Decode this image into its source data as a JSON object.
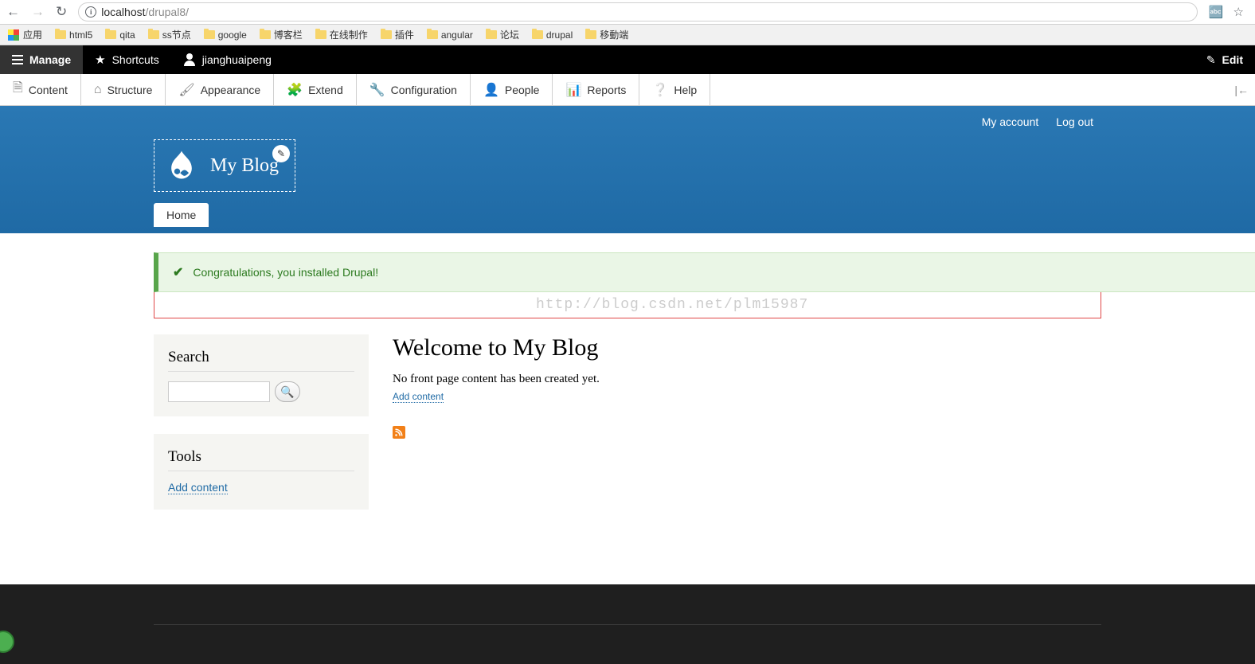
{
  "browser": {
    "url_host": "localhost",
    "url_rest": "/drupal8/",
    "apps_label": "应用",
    "bookmarks": [
      "html5",
      "qita",
      "ss节点",
      "google",
      "博客栏",
      "在线制作",
      "插件",
      "angular",
      "论坛",
      "drupal",
      "移動端"
    ]
  },
  "adminbar": {
    "manage": "Manage",
    "shortcuts": "Shortcuts",
    "user": "jianghuaipeng",
    "edit": "Edit"
  },
  "admintabs": [
    "Content",
    "Structure",
    "Appearance",
    "Extend",
    "Configuration",
    "People",
    "Reports",
    "Help"
  ],
  "userlinks": {
    "myaccount": "My account",
    "logout": "Log out"
  },
  "branding": {
    "site_name": "My Blog"
  },
  "nav": {
    "home": "Home"
  },
  "message": {
    "text": "Congratulations, you installed Drupal!"
  },
  "watermark": "http://blog.csdn.net/plm15987",
  "sidebar": {
    "search": {
      "title": "Search",
      "value": ""
    },
    "tools": {
      "title": "Tools",
      "add": "Add content"
    }
  },
  "main": {
    "title": "Welcome to My Blog",
    "body": "No front page content has been created yet.",
    "add": "Add content"
  }
}
